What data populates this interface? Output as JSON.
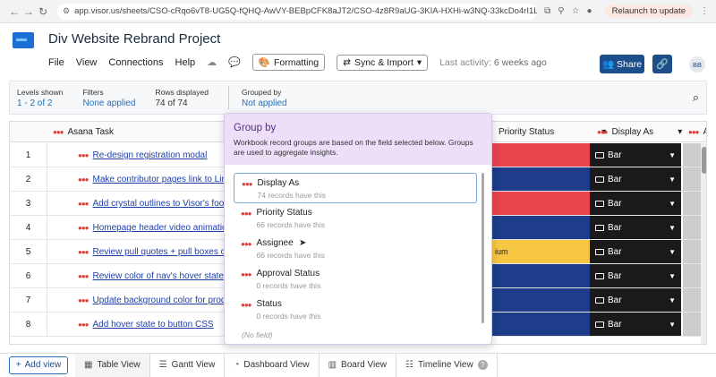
{
  "browser": {
    "url": "app.visor.us/sheets/CSO-cRqo6vT8-UG5Q-fQHQ-AwVY-BEBpCFK8aJT2/CSO-4z8R9aUG-3KIA-HXHi-w3NQ-33kcDo4rI1Ld",
    "relaunch_label": "Relaunch to update"
  },
  "header": {
    "project_title": "Div Website Rebrand Project",
    "menu": [
      "File",
      "View",
      "Connections",
      "Help"
    ],
    "formatting_label": "Formatting",
    "sync_label": "Sync & Import",
    "last_activity_label": "Last activity:",
    "last_activity_value": "6 weeks ago",
    "share_label": "Share",
    "avatar_initials": "BB"
  },
  "filterbar": {
    "levels_label": "Levels shown",
    "levels_value": "1 - 2 of 2",
    "filters_label": "Filters",
    "filters_value": "None applied",
    "rows_label": "Rows displayed",
    "rows_value": "74 of 74",
    "grouped_label": "Grouped by",
    "grouped_value": "Not applied"
  },
  "grid": {
    "col_task": "Asana Task",
    "col_priority": "Priority Status",
    "col_display": "Display As",
    "col_extra": "Ap",
    "rows": [
      {
        "num": "1",
        "task": "Re-design registration modal",
        "prio_color": "#e8444e",
        "prio_text": "",
        "display": "Bar"
      },
      {
        "num": "2",
        "task": "Make contributor pages link to Lin",
        "prio_color": "#1d3c8a",
        "prio_text": "",
        "display": "Bar"
      },
      {
        "num": "3",
        "task": "Add crystal outlines to Visor's foot",
        "prio_color": "#e8444e",
        "prio_text": "",
        "display": "Bar"
      },
      {
        "num": "4",
        "task": "Homepage header video animation",
        "prio_color": "#1d3c8a",
        "prio_text": "",
        "display": "Bar"
      },
      {
        "num": "5",
        "task": "Review pull quotes + pull boxes on",
        "prio_color": "#f7c744",
        "prio_text": "ium",
        "display": "Bar"
      },
      {
        "num": "6",
        "task": "Review color of nav's hover state",
        "prio_color": "#1d3c8a",
        "prio_text": "",
        "display": "Bar"
      },
      {
        "num": "7",
        "task": "Update background color for prod",
        "prio_color": "#1d3c8a",
        "prio_text": "",
        "display": "Bar"
      },
      {
        "num": "8",
        "task": "Add hover state to button CSS",
        "prio_color": "#1d3c8a",
        "prio_text": "",
        "display": "Bar"
      }
    ]
  },
  "popup": {
    "title": "Group by",
    "description": "Workbook record groups are based on the field selected below. Groups are used to aggregate insights.",
    "options": [
      {
        "name": "Display As",
        "count": "74 records have this"
      },
      {
        "name": "Priority Status",
        "count": "66 records have this"
      },
      {
        "name": "Assignee",
        "count": "66 records have this"
      },
      {
        "name": "Approval Status",
        "count": "0 records have this"
      },
      {
        "name": "Status",
        "count": "0 records have this"
      }
    ],
    "no_field": "(No field)"
  },
  "bottom": {
    "add_view": "Add view",
    "tabs": [
      "Table View",
      "Gantt View",
      "Dashboard View",
      "Board View",
      "Timeline View"
    ]
  }
}
